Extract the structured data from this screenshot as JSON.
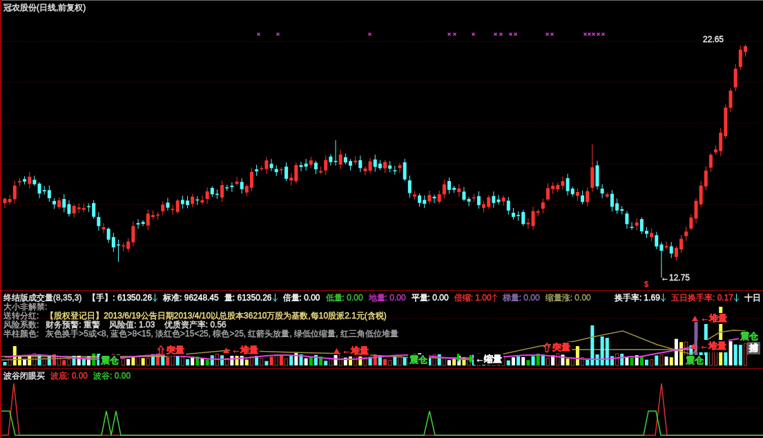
{
  "price_panel": {
    "title": "冠农股份(日线,前复权)",
    "high_label": "22.65",
    "low_label": "←12.75",
    "signal": "$"
  },
  "volume_panel": {
    "title": "终结版成交量(8,35,3)",
    "readouts": [
      {
        "text": "【手】: 61350.26",
        "arrow": {
          "kind": "down",
          "color": "#54ffff"
        },
        "color": "#ffffff"
      },
      {
        "text": "标准: 96248.45",
        "color": "#ffffff"
      },
      {
        "text": "量: 61350.26",
        "arrow": {
          "kind": "down",
          "color": "#54ffff"
        },
        "color": "#ffffff"
      },
      {
        "text": "倍量: 0.00",
        "color": "#ffffff"
      },
      {
        "text": "低量: 0.00",
        "color": "#33cc33"
      },
      {
        "text": "地量: 0.00",
        "color": "#cc33cc"
      },
      {
        "text": "平量: 0.00",
        "color": "#ffffff"
      },
      {
        "text": "倍缩: 1.00",
        "arrow": {
          "kind": "up",
          "color": "#ff3232"
        },
        "color": "#ff3232"
      },
      {
        "text": "梯量: 0.00",
        "color": "#8c70b0"
      },
      {
        "text": "缩量涨: 0.00",
        "color": "#a0a060"
      }
    ],
    "turnover": [
      {
        "text": "换手率: 1.69",
        "arrow": {
          "kind": "down",
          "color": "#54ffff"
        },
        "color": "#ffffff"
      },
      {
        "text": "五日换手率: 0.17",
        "arrow": {
          "kind": "down",
          "color": "#54ffff"
        },
        "color": "#ff3232"
      },
      {
        "text": "十日",
        "color": "#ffffff"
      }
    ],
    "info_lines": [
      {
        "label": "大小非解禁:"
      },
      {
        "label": "送转分红:",
        "text": "【股权登记日】2013/6/19公告日期2013/4/10以总股本36210万股为基数,每10股派2.1元(含税)",
        "color": "#f0e080"
      },
      {
        "label": "风险系数:",
        "text": "财务预警: 重警    风险值: 1.03    优质资产率: 0.56",
        "color": "#e0e0e0"
      },
      {
        "label": "半柱颜色:",
        "text": "灰色换手>5或<8, 蓝色>8<15, 淡红色>15<25, 棕色>25, 红箭头放量, 绿低位缩量, 红三角低位堆量",
        "color": "#a8a8a8"
      }
    ],
    "annotations": [
      {
        "kind": "plain",
        "text": "震仓",
        "color": "#33cc33"
      },
      {
        "kind": "burst",
        "text": "突量",
        "color": "#ff3232"
      },
      {
        "kind": "pile",
        "text": "←堆量",
        "color": "#ff3232"
      },
      {
        "kind": "pile",
        "text": "←堆量",
        "color": "#ff3232"
      },
      {
        "kind": "plain",
        "text": "震仓",
        "color": "#33cc33"
      },
      {
        "kind": "drop",
        "text": "←缩量",
        "color": "#ffffff"
      },
      {
        "kind": "burst",
        "text": "突量",
        "color": "#ff3232"
      },
      {
        "kind": "plain",
        "text": "震仓",
        "color": "#33cc33"
      },
      {
        "kind": "pile",
        "text": "←堆量",
        "color": "#ff3232"
      },
      {
        "kind": "pile",
        "text": "←堆量",
        "color": "#ff3232"
      },
      {
        "kind": "plain",
        "text": "震仓",
        "color": "#33cc33"
      },
      {
        "kind": "tag",
        "text": "捕",
        "color": "#ffffff"
      }
    ]
  },
  "signal_panel": {
    "title": "波谷闭眼买",
    "readouts": [
      {
        "text": "波底: 0.00",
        "color": "#ff3232"
      },
      {
        "text": "波谷: 0.00",
        "color": "#33cc33"
      }
    ]
  }
}
